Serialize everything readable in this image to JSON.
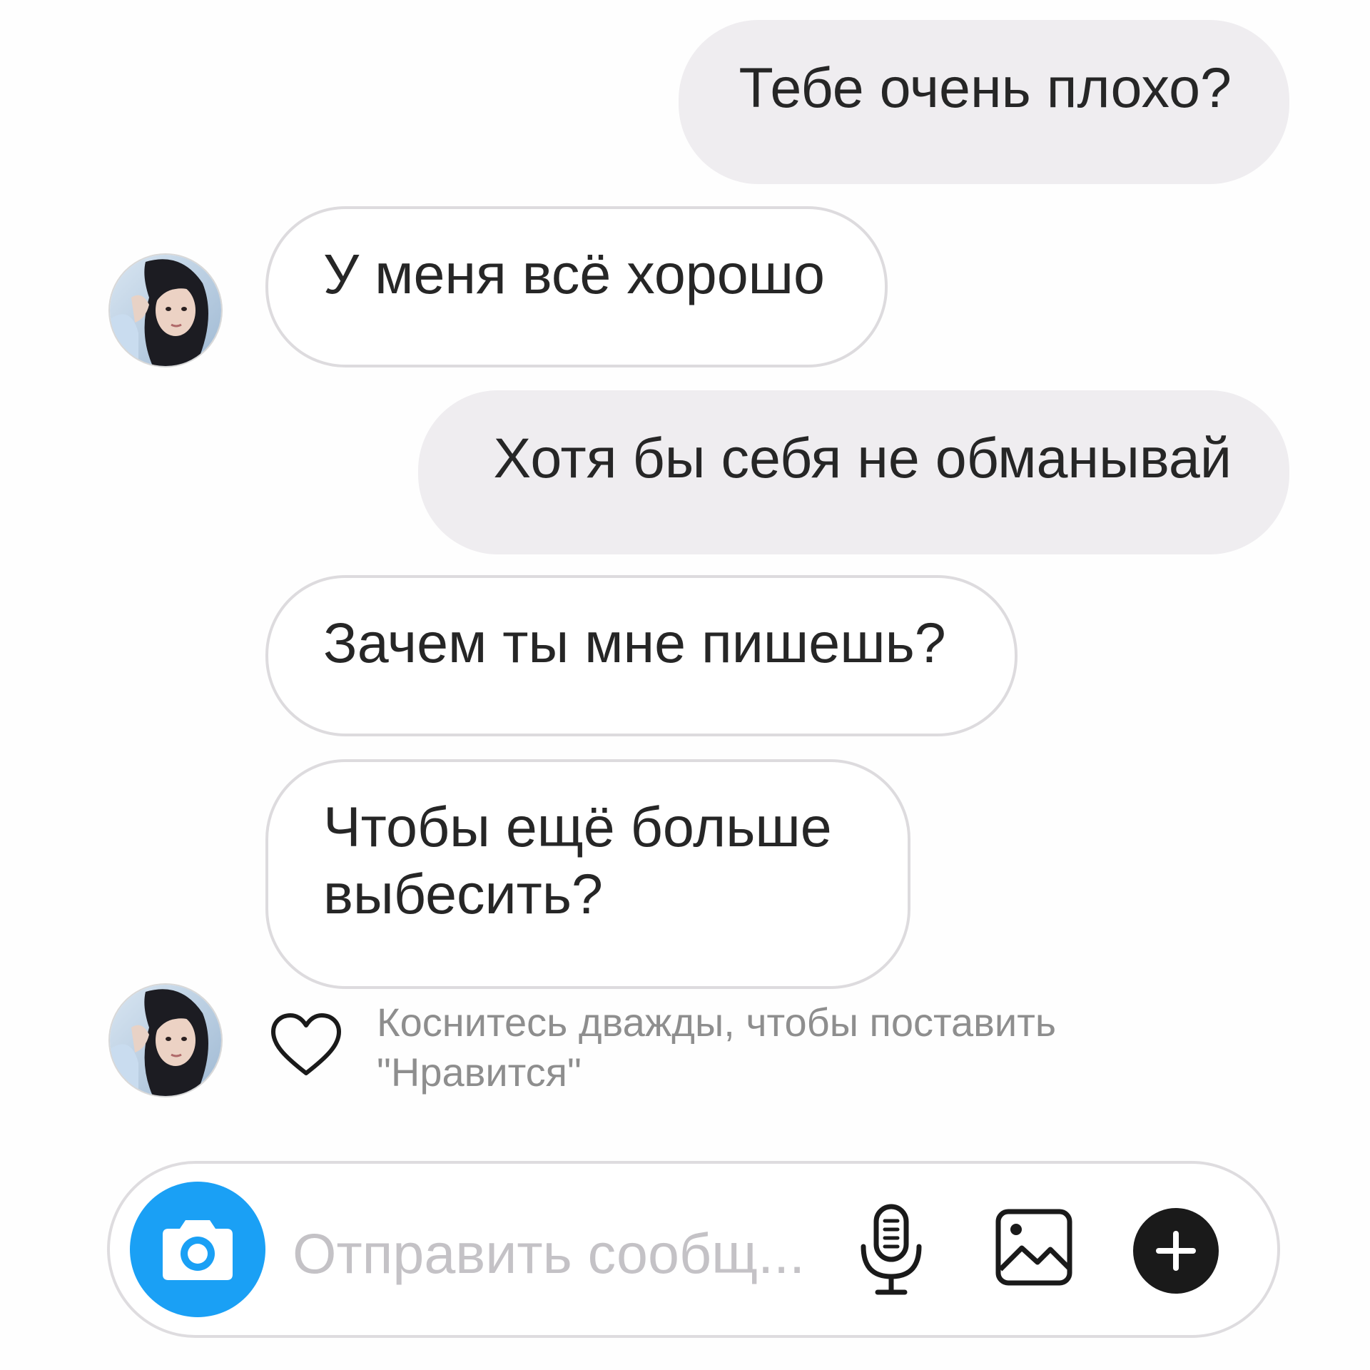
{
  "messages": [
    {
      "direction": "outgoing",
      "text": "Тебе очень плохо?"
    },
    {
      "direction": "incoming",
      "text": "У меня всё хорошо"
    },
    {
      "direction": "outgoing",
      "text": "Хотя бы себя не обманывай"
    },
    {
      "direction": "incoming",
      "text": "Зачем ты мне пишешь?"
    },
    {
      "direction": "incoming",
      "text_lines": [
        "Чтобы ещё больше",
        "выбесить?"
      ]
    }
  ],
  "like_hint": {
    "icon": "heart-outline-icon",
    "lines": [
      "Коснитесь дважды, чтобы поставить",
      "\"Нравится\""
    ]
  },
  "composer": {
    "placeholder": "Отправить сообщ...",
    "camera_icon": "camera-icon",
    "mic_icon": "microphone-icon",
    "gallery_icon": "gallery-icon",
    "plus_icon": "plus-icon"
  },
  "colors": {
    "outgoing_bubble": "#efedf0",
    "incoming_border": "#dddbde",
    "camera_button": "#1aa0f5",
    "hint_text": "#8e8e8e",
    "placeholder_text": "#c4c2c6",
    "plus_button": "#1a1a1a"
  }
}
